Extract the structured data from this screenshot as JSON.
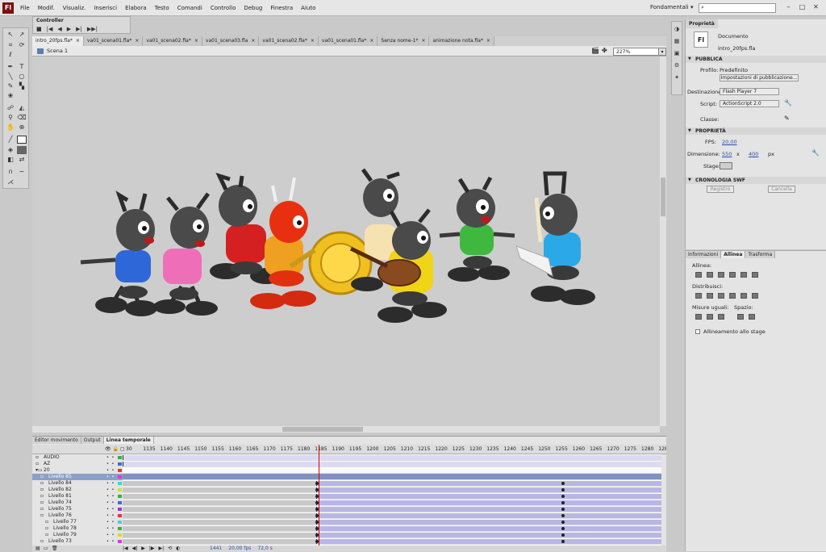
{
  "menubar": {
    "app_logo": "Fl",
    "menus": [
      "File",
      "Modif.",
      "Visualiz.",
      "Inserisci",
      "Elabora",
      "Testo",
      "Comandi",
      "Controllo",
      "Debug",
      "Finestra",
      "Aiuto"
    ],
    "workspace": "Fondamentali",
    "search_placeholder": ""
  },
  "controller": {
    "title": "Controller"
  },
  "doc_tabs": [
    {
      "label": "intro_20fps.fla*",
      "active": true
    },
    {
      "label": "va01_scena01.fla*",
      "active": false
    },
    {
      "label": "va01_scena02.fla*",
      "active": false
    },
    {
      "label": "va01_scena03.fla",
      "active": false
    },
    {
      "label": "va01_scena02.fla*",
      "active": false
    },
    {
      "label": "va01_scena01.fla*",
      "active": false
    },
    {
      "label": "Senza nome-1*",
      "active": false
    },
    {
      "label": "animazione nota.fla*",
      "active": false
    }
  ],
  "edit_bar": {
    "scene": "Scena 1",
    "zoom": "227%"
  },
  "timeline": {
    "tabs": [
      {
        "label": "Editor movimento",
        "active": false
      },
      {
        "label": "Output",
        "active": false
      },
      {
        "label": "Linea temporale",
        "active": true
      }
    ],
    "frame_numbers": [
      "30",
      "1135",
      "1140",
      "1145",
      "1150",
      "1155",
      "1160",
      "1165",
      "1170",
      "1175",
      "1180",
      "1185",
      "1190",
      "1195",
      "1200",
      "1205",
      "1210",
      "1215",
      "1220",
      "1225",
      "1230",
      "1235",
      "1240",
      "1245",
      "1250",
      "1255",
      "1260",
      "1265",
      "1270",
      "1275",
      "1280",
      "128"
    ],
    "layers": [
      {
        "name": "AUDIO",
        "indent": 0,
        "type": "layer",
        "selected": false,
        "color": "#3bb33b"
      },
      {
        "name": "AZ",
        "indent": 0,
        "type": "layer",
        "selected": false,
        "color": "#3b6bd8"
      },
      {
        "name": "20",
        "indent": 0,
        "type": "folder",
        "selected": false,
        "color": "#d83b3b"
      },
      {
        "name": "Livello 85",
        "indent": 1,
        "type": "layer",
        "selected": true,
        "color": "#d83bd8"
      },
      {
        "name": "Livello 84",
        "indent": 1,
        "type": "layer",
        "selected": false,
        "color": "#3bd8d8"
      },
      {
        "name": "Livello 82",
        "indent": 1,
        "type": "layer",
        "selected": false,
        "color": "#d8d83b"
      },
      {
        "name": "Livello 81",
        "indent": 1,
        "type": "layer",
        "selected": false,
        "color": "#3bb33b"
      },
      {
        "name": "Livello 74",
        "indent": 1,
        "type": "layer",
        "selected": false,
        "color": "#3b6bd8"
      },
      {
        "name": "Livello 75",
        "indent": 1,
        "type": "layer",
        "selected": false,
        "color": "#8a3bd8"
      },
      {
        "name": "Livello 76",
        "indent": 1,
        "type": "layer",
        "selected": false,
        "color": "#d83b3b"
      },
      {
        "name": "Livello 77",
        "indent": 2,
        "type": "layer",
        "selected": false,
        "color": "#3bd8d8"
      },
      {
        "name": "Livello 78",
        "indent": 2,
        "type": "layer",
        "selected": false,
        "color": "#3bb33b"
      },
      {
        "name": "Livello 79",
        "indent": 2,
        "type": "layer",
        "selected": false,
        "color": "#d8d83b"
      },
      {
        "name": "Livello 73",
        "indent": 1,
        "type": "layer",
        "selected": false,
        "color": "#d83bd8"
      }
    ],
    "footer": {
      "frame": "1441",
      "fps": "20,00 fps",
      "time": "72,0 s"
    }
  },
  "properties": {
    "tab": "Proprietà",
    "doc_icon": "Fl",
    "doc_type": "Documento",
    "doc_name": "intro_20fps.fla",
    "sections": {
      "publish": "PUBBLICA",
      "properties": "PROPRIETÀ",
      "swf_history": "CRONOLOGIA SWF"
    },
    "profile_label": "Profilo:",
    "profile_value": "Predefinito",
    "publish_settings_button": "Impostazioni di pubblicazione...",
    "target_label": "Destinazione:",
    "target_value": "Flash Player 7",
    "script_label": "Script:",
    "script_value": "ActionScript 2.0",
    "class_label": "Classe:",
    "fps_label": "FPS:",
    "fps_value": "20,00",
    "size_label": "Dimensione:",
    "width": "550",
    "x_sep": "x",
    "height": "400",
    "unit": "px",
    "stage_label": "Stage:",
    "stage_color": "#cdcdcd",
    "log_button": "Registro",
    "clear_button": "Cancella"
  },
  "align_panel": {
    "tabs": [
      {
        "label": "Informazioni",
        "active": false
      },
      {
        "label": "Allinea",
        "active": true
      },
      {
        "label": "Trasforma",
        "active": false
      }
    ],
    "align_label": "Allinea:",
    "distribute_label": "Distribuisci:",
    "match_size_label": "Misure uguali:",
    "space_label": "Spazio:",
    "align_to_stage": "Allineamento allo stage"
  }
}
